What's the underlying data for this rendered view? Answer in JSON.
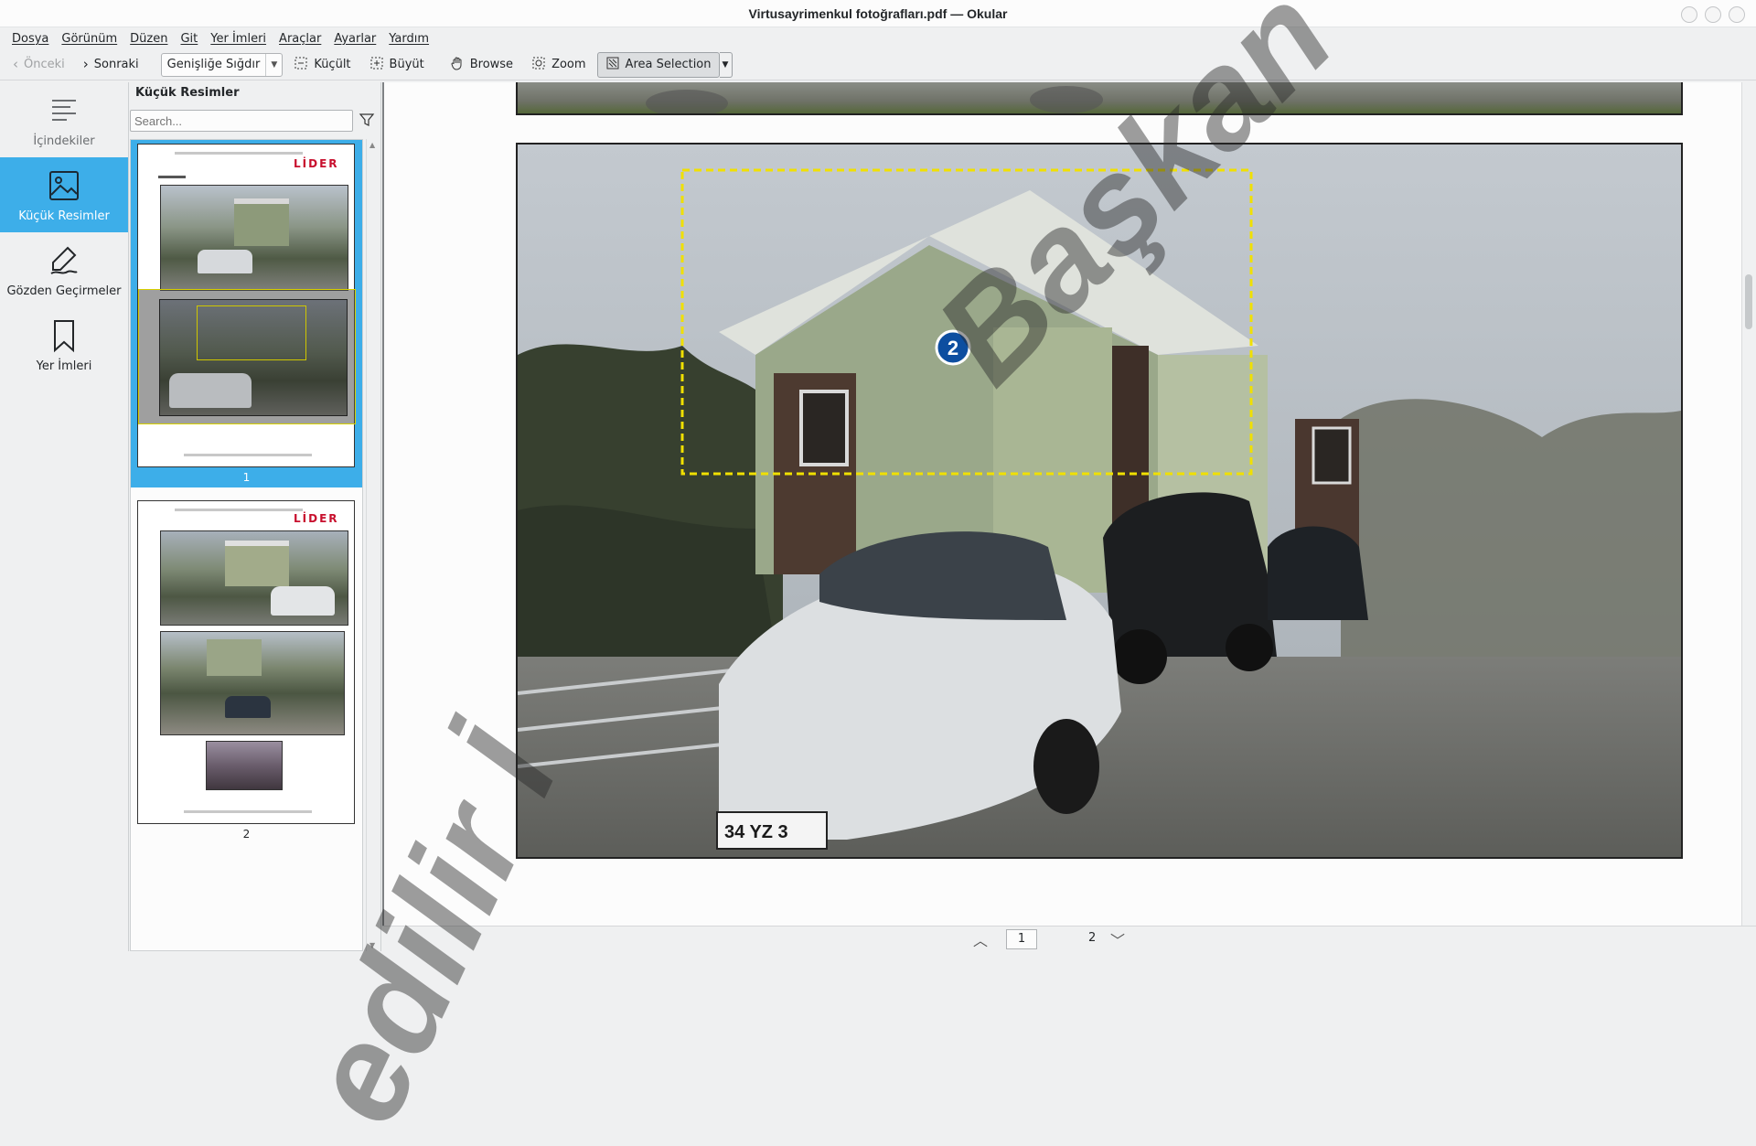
{
  "window": {
    "title": "Virtusayrimenkul fotoğrafları.pdf — Okular"
  },
  "menu": [
    "Dosya",
    "Görünüm",
    "Düzen",
    "Git",
    "Yer İmleri",
    "Araçlar",
    "Ayarlar",
    "Yardım"
  ],
  "toolbar": {
    "prev": "Önceki",
    "next": "Sonraki",
    "zoom_mode": "Genişliğe Sığdır",
    "zoom_out": "Küçült",
    "zoom_in": "Büyüt",
    "browse": "Browse",
    "zoom": "Zoom",
    "area_selection": "Area Selection"
  },
  "sidebar": {
    "items": [
      {
        "label": "İçindekiler",
        "icon": "toc-icon"
      },
      {
        "label": "Küçük Resimler",
        "icon": "image-icon"
      },
      {
        "label": "Gözden Geçirmeler",
        "icon": "pen-icon"
      },
      {
        "label": "Yer İmleri",
        "icon": "bookmark-icon"
      }
    ]
  },
  "thumbnails": {
    "title": "Küçük Resimler",
    "search_placeholder": "Search...",
    "pages": [
      "1",
      "2"
    ],
    "brand": "LİDER"
  },
  "main": {
    "marker": "2",
    "plate": "34 YZ 3"
  },
  "pagenav": {
    "current": "1",
    "total": "2"
  },
  "watermark": {
    "text_1": "Başkan",
    "text_2": "edilir İ"
  },
  "colors": {
    "accent": "#3daee9",
    "selection_rect": "#f0e000"
  }
}
